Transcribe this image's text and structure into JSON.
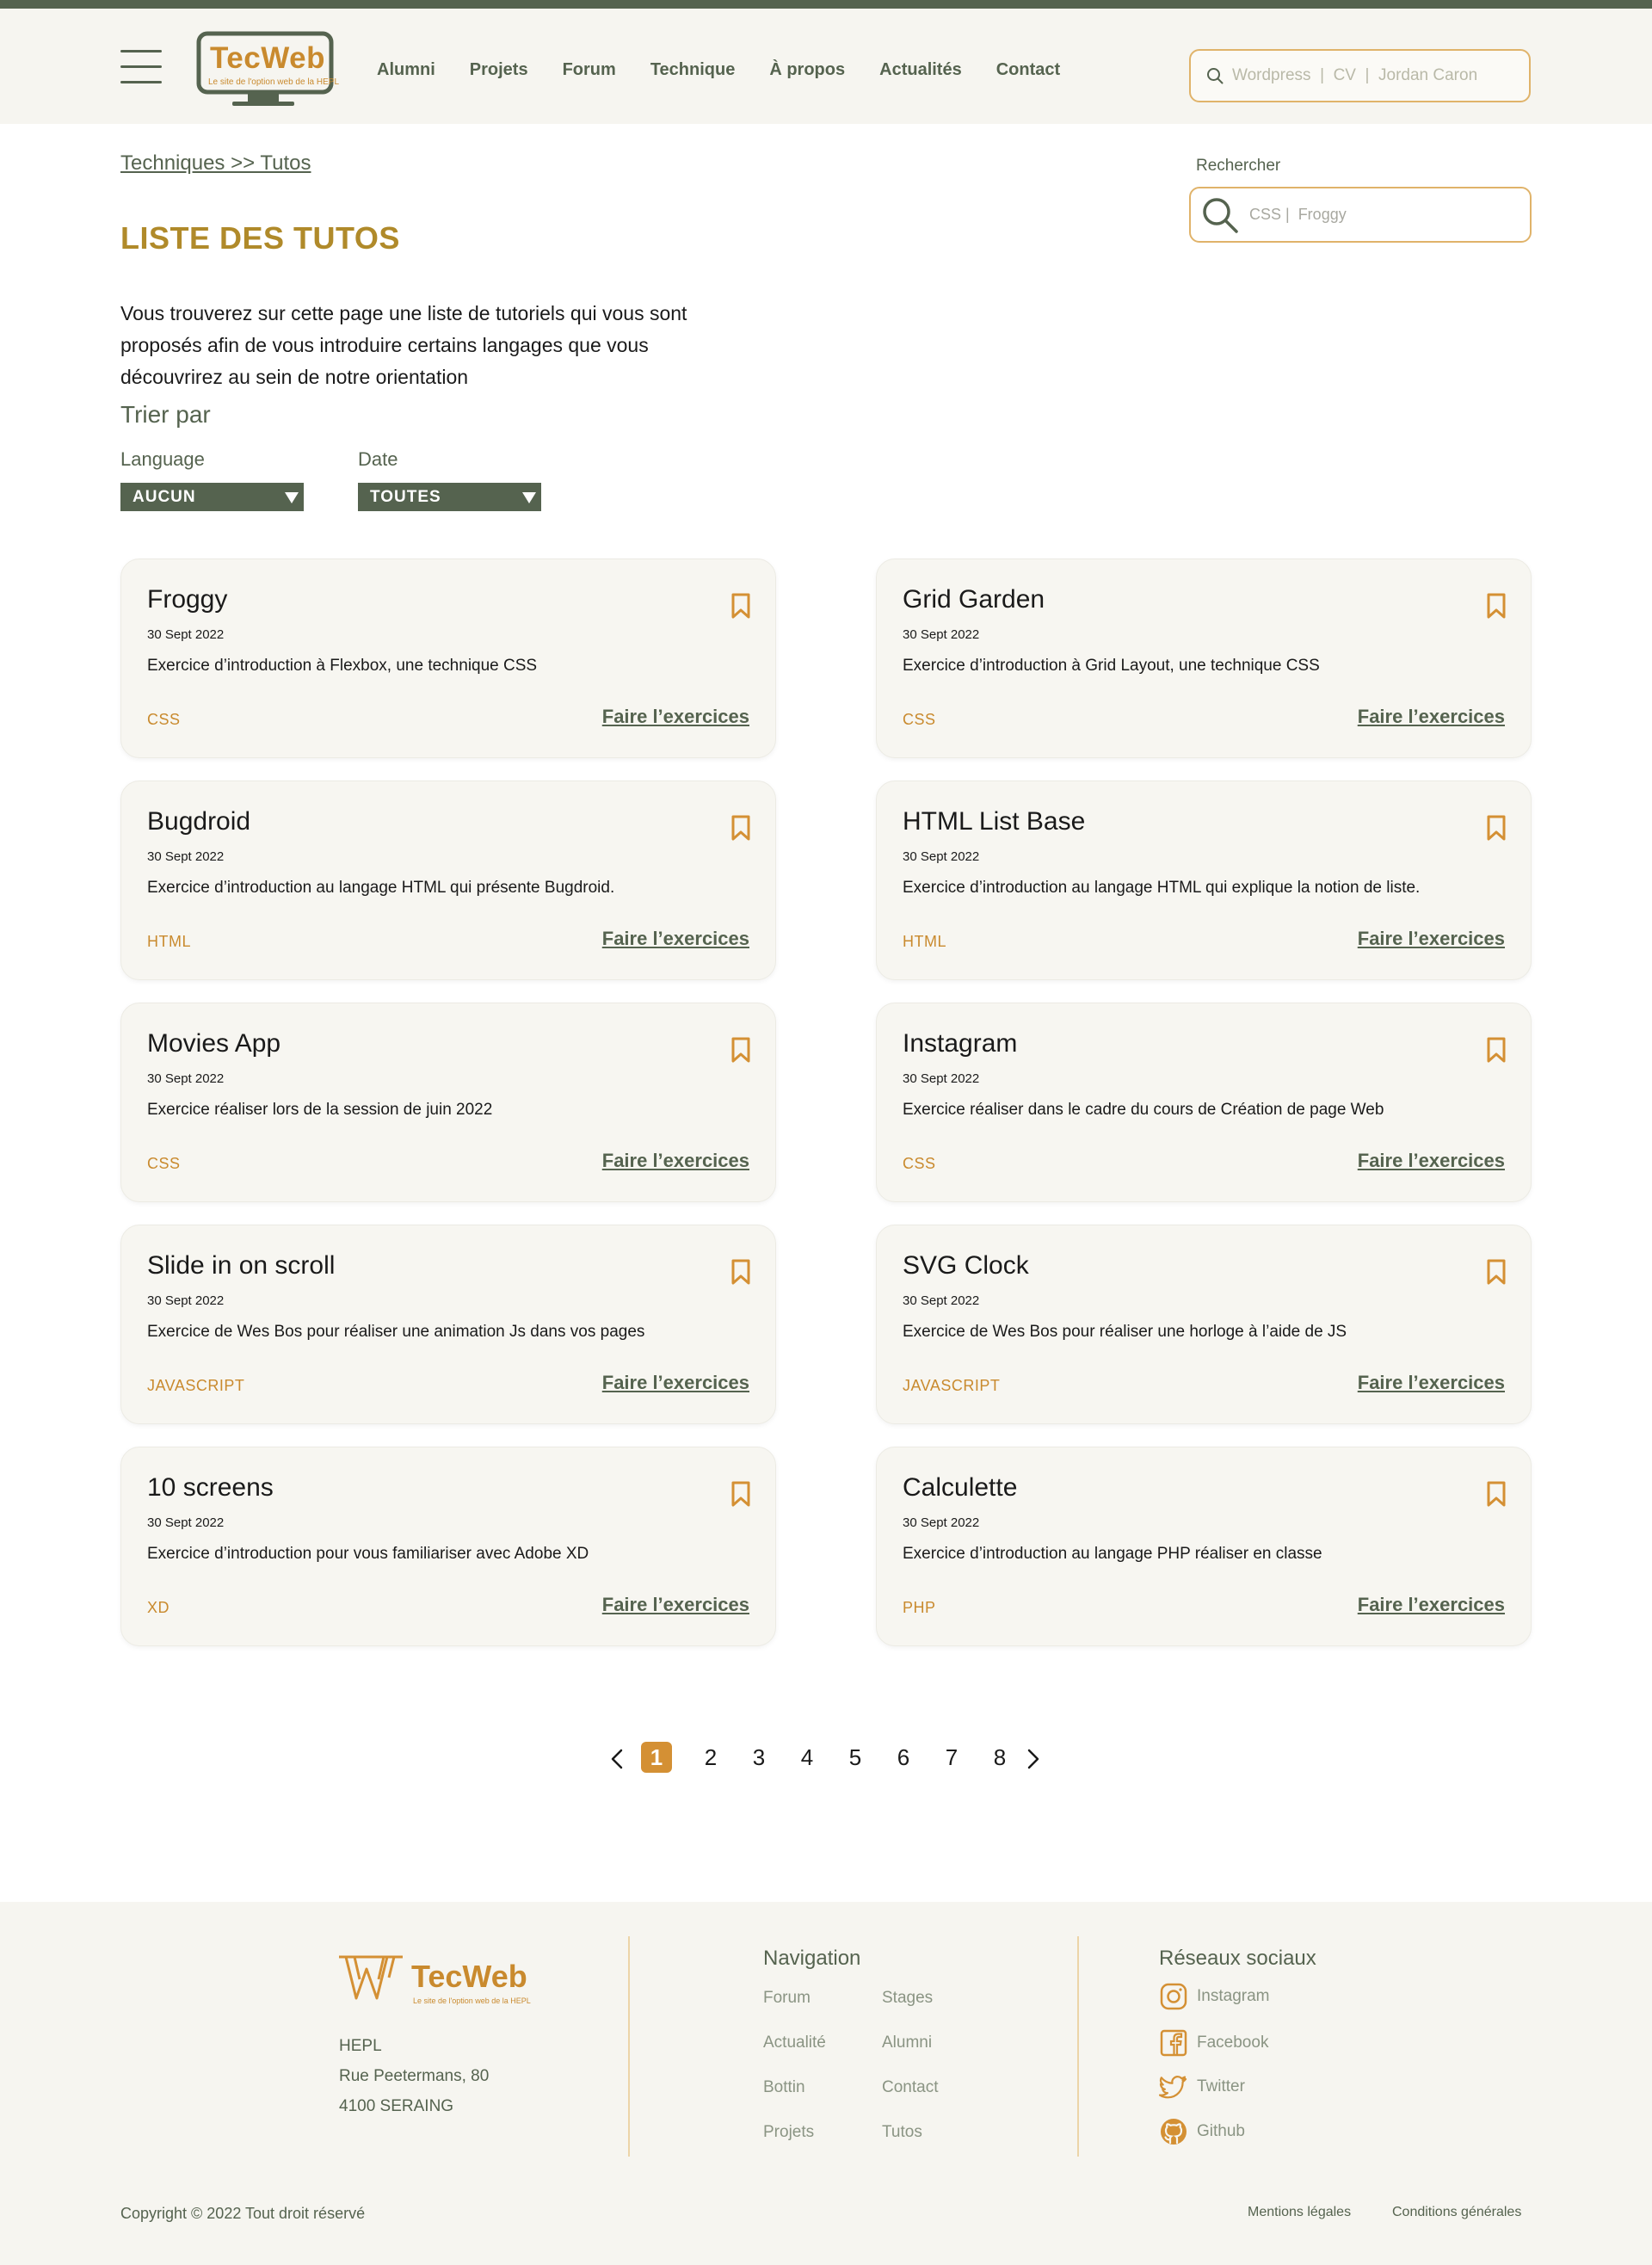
{
  "header": {
    "logo_name": "TecWeb",
    "logo_tagline": "Le site de l'option web de la HEPL",
    "nav": [
      "Alumni",
      "Projets",
      "Forum",
      "Technique",
      "À propos",
      "Actualités",
      "Contact"
    ],
    "search_placeholder": "Wordpress  |  CV  |  Jordan Caron"
  },
  "main": {
    "breadcrumb": "Techniques >> Tutos",
    "title": "LISTE DES TUTOS",
    "intro": "Vous trouverez sur cette page une liste de tutoriels qui vous sont proposés afin de vous introduire certains langages que vous découvrirez au sein de notre orientation",
    "sort_title": "Trier par",
    "filters": {
      "language_label": "Language",
      "language_value": "AUCUN",
      "date_label": "Date",
      "date_value": "TOUTES"
    },
    "side_search": {
      "label": "Rechercher",
      "placeholder": "CSS |  Froggy"
    },
    "card_link_label": "Faire l’exercices",
    "cards": [
      {
        "title": "Froggy",
        "date": "30 Sept 2022",
        "desc": "Exercice d’introduction à Flexbox, une technique CSS",
        "tag": "CSS"
      },
      {
        "title": "Grid Garden",
        "date": "30 Sept 2022",
        "desc": "Exercice d’introduction à Grid Layout, une technique CSS",
        "tag": "CSS"
      },
      {
        "title": "Bugdroid",
        "date": "30 Sept 2022",
        "desc": "Exercice d’introduction au langage HTML qui présente Bugdroid.",
        "tag": "HTML"
      },
      {
        "title": "HTML List Base",
        "date": "30 Sept 2022",
        "desc": "Exercice d’introduction au langage HTML qui explique la notion de liste.",
        "tag": "HTML"
      },
      {
        "title": "Movies App",
        "date": "30 Sept 2022",
        "desc": "Exercice réaliser lors de la session de juin 2022",
        "tag": "CSS"
      },
      {
        "title": "Instagram",
        "date": "30 Sept 2022",
        "desc": "Exercice réaliser dans le cadre du cours de Création de page Web",
        "tag": "CSS"
      },
      {
        "title": "Slide in on scroll",
        "date": "30 Sept 2022",
        "desc": "Exercice de Wes Bos pour réaliser une animation Js dans vos pages",
        "tag": "JAVASCRIPT"
      },
      {
        "title": "SVG Clock",
        "date": "30 Sept 2022",
        "desc": "Exercice de Wes Bos pour réaliser une horloge à l’aide de JS",
        "tag": "JAVASCRIPT"
      },
      {
        "title": "10 screens",
        "date": "30 Sept 2022",
        "desc": "Exercice d’introduction pour vous familiariser avec Adobe XD",
        "tag": "XD"
      },
      {
        "title": "Calculette",
        "date": "30 Sept 2022",
        "desc": "Exercice d’introduction au langage PHP réaliser en classe",
        "tag": "PHP"
      }
    ],
    "pagination": {
      "pages": [
        "1",
        "2",
        "3",
        "4",
        "5",
        "6",
        "7",
        "8"
      ],
      "current": "1"
    }
  },
  "footer": {
    "logo_name": "TecWeb",
    "logo_tagline": "Le site de l'option web de la HEPL",
    "address": [
      "HEPL",
      "Rue Peetermans, 80",
      "4100 SERAING"
    ],
    "nav_heading": "Navigation",
    "nav_col1": [
      "Forum",
      "Actualité",
      "Bottin",
      "Projets"
    ],
    "nav_col2": [
      "Stages",
      "Alumni",
      "Contact",
      "Tutos"
    ],
    "social_heading": "Réseaux sociaux",
    "social": [
      "Instagram",
      "Facebook",
      "Twitter",
      "Github"
    ],
    "copyright": "Copyright © 2022 Tout droit réservé",
    "legal": [
      "Mentions légales",
      "Conditions générales"
    ]
  },
  "colors": {
    "accent_green": "#55634f",
    "accent_orange": "#c98a2e",
    "title_gold": "#b08a2a",
    "background_cream": "#f6f5f0"
  }
}
